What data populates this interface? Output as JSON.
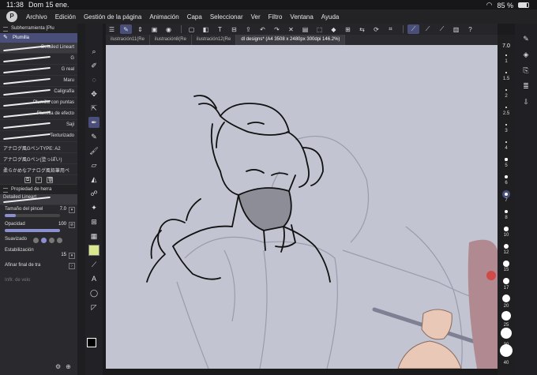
{
  "status": {
    "time": "11:38",
    "date": "Dom 15 ene.",
    "battery": "85 %"
  },
  "menu": [
    "Archivo",
    "Edición",
    "Gestión de la página",
    "Animación",
    "Capa",
    "Seleccionar",
    "Ver",
    "Filtro",
    "Ventana",
    "Ayuda"
  ],
  "tabs": [
    "ilustración11(Re",
    "ilustración8(Re",
    "ilustración12(Re",
    "dl designs* (A4 3508 x 2480px 300dpi 146.2%)"
  ],
  "subtool_panel": {
    "title": "Subherramienta [Plu",
    "group": "Plumilla",
    "header_brush": "Detailed Lineart",
    "brushes": [
      "G",
      "G real",
      "Maru",
      "Caligrafía",
      "Plumilla con puntas",
      "Plumilla de efecto",
      "Saji",
      "Texturizado",
      "アナログ風GペンTYPE: A2",
      "アナログ風Gペン(塗っぽい)",
      "柔らかめなアナログ風鉛筆用ペ"
    ]
  },
  "tool_property": {
    "title": "Propiedad de herra",
    "brush": "Detailed Lineart",
    "brush_size_label": "Tamaño del pincel",
    "brush_size": "7.0",
    "opacity_label": "Opacidad",
    "opacity": "100",
    "anti_alias_label": "Suavizado",
    "stabilization_label": "Estabilización",
    "stabilization": "15",
    "taper_label": "Afinar final de tra",
    "speed_label": "Inflr. de velo"
  },
  "brush_sizes": [
    "7.0",
    "1",
    "1.5",
    "2",
    "2.5",
    "3",
    "4",
    "5",
    "6",
    "7",
    "8",
    "10",
    "12",
    "15",
    "17",
    "20",
    "25",
    "30",
    "40"
  ],
  "colors": {
    "canvas": "#c2c4d1",
    "accent": "#4a4f7a",
    "panel": "#2a2a2e",
    "fg_color": "#000000",
    "bg_color": "#ffffff"
  }
}
